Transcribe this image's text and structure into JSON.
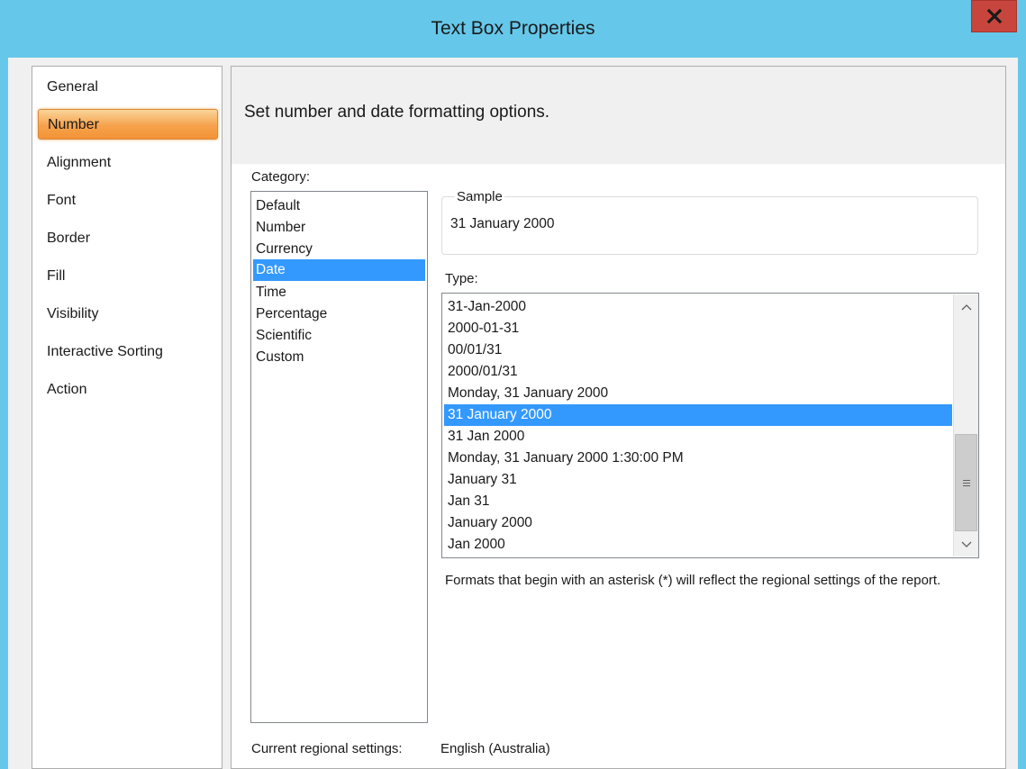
{
  "window": {
    "title": "Text Box Properties",
    "close_label": "X"
  },
  "nav": {
    "items": [
      {
        "label": "General",
        "selected": false
      },
      {
        "label": "Number",
        "selected": true
      },
      {
        "label": "Alignment",
        "selected": false
      },
      {
        "label": "Font",
        "selected": false
      },
      {
        "label": "Border",
        "selected": false
      },
      {
        "label": "Fill",
        "selected": false
      },
      {
        "label": "Visibility",
        "selected": false
      },
      {
        "label": "Interactive Sorting",
        "selected": false
      },
      {
        "label": "Action",
        "selected": false
      }
    ]
  },
  "header": {
    "text": "Set number and date formatting options."
  },
  "category": {
    "label": "Category:",
    "items": [
      "Default",
      "Number",
      "Currency",
      "Date",
      "Time",
      "Percentage",
      "Scientific",
      "Custom"
    ],
    "selected": "Date"
  },
  "sample": {
    "label": "Sample",
    "value": "31 January 2000"
  },
  "type": {
    "label": "Type:",
    "items": [
      "31-Jan-2000",
      "2000-01-31",
      "00/01/31",
      "2000/01/31",
      "Monday, 31 January 2000",
      "31 January 2000",
      "31 Jan 2000",
      "Monday, 31 January 2000 1:30:00 PM",
      "January 31",
      "Jan 31",
      "January 2000",
      "Jan 2000"
    ],
    "selected": "31 January 2000"
  },
  "note": {
    "text": "Formats that begin with an asterisk (*) will reflect the regional settings of the report."
  },
  "regional": {
    "label": "Current regional settings:",
    "value": "English (Australia)"
  },
  "colors": {
    "titlebar": "#65c8ea",
    "close": "#c8453d",
    "selection": "#3399ff",
    "nav_selected": "#f6a24c"
  }
}
